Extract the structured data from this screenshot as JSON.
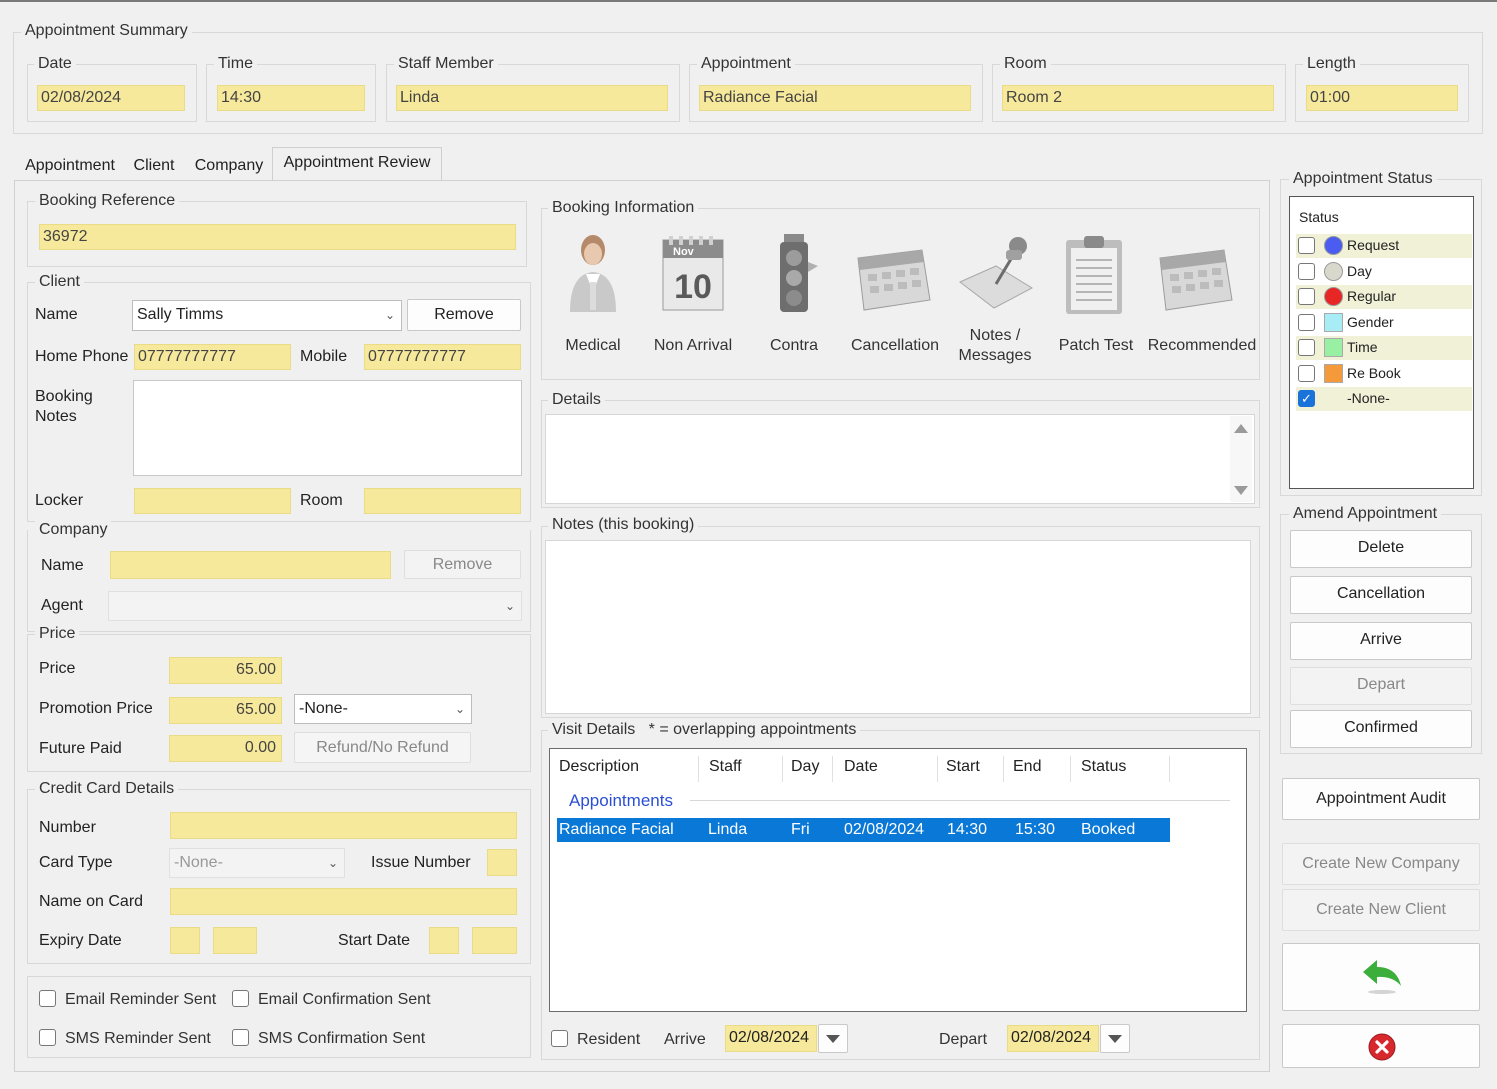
{
  "summary": {
    "title": "Appointment Summary",
    "date_label": "Date",
    "date": "02/08/2024",
    "time_label": "Time",
    "time": "14:30",
    "staff_label": "Staff Member",
    "staff": "Linda",
    "appt_label": "Appointment",
    "appt": "Radiance Facial",
    "room_label": "Room",
    "room": "Room 2",
    "length_label": "Length",
    "length": "01:00"
  },
  "tabs": [
    "Appointment",
    "Client",
    "Company",
    "Appointment Review"
  ],
  "booking_ref": {
    "title": "Booking Reference",
    "value": "36972"
  },
  "client": {
    "title": "Client",
    "name_label": "Name",
    "name": "Sally Timms",
    "remove": "Remove",
    "home_label": "Home Phone",
    "home": "07777777777",
    "mobile_label": "Mobile",
    "mobile": "07777777777",
    "notes_label_1": "Booking",
    "notes_label_2": "Notes",
    "locker_label": "Locker",
    "room_label": "Room"
  },
  "company": {
    "title": "Company",
    "name_label": "Name",
    "remove": "Remove",
    "agent_label": "Agent"
  },
  "price": {
    "title": "Price",
    "price_label": "Price",
    "price": "65.00",
    "promo_label": "Promotion Price",
    "promo": "65.00",
    "promo_select": "-None-",
    "future_label": "Future Paid",
    "future": "0.00",
    "refund": "Refund/No Refund"
  },
  "card": {
    "title": "Credit Card Details",
    "number_label": "Number",
    "type_label": "Card Type",
    "type_value": "-None-",
    "issue_label": "Issue Number",
    "name_label": "Name on Card",
    "expiry_label": "Expiry Date",
    "start_label": "Start Date"
  },
  "reminders": {
    "email_reminder": "Email Reminder Sent",
    "email_confirm": "Email Confirmation Sent",
    "sms_reminder": "SMS Reminder Sent",
    "sms_confirm": "SMS Confirmation Sent"
  },
  "booking_info": {
    "title": "Booking Information",
    "items": [
      "Medical",
      "Non Arrival",
      "Contra",
      "Cancellation",
      "Notes /",
      "Messages",
      "Patch Test",
      "Recommended"
    ],
    "calendar_month": "Nov",
    "calendar_day": "10"
  },
  "details": {
    "title": "Details"
  },
  "notes": {
    "title": "Notes (this booking)"
  },
  "visit": {
    "title": "Visit Details",
    "note": "* = overlapping appointments",
    "columns": [
      "Description",
      "Staff",
      "Day",
      "Date",
      "Start",
      "End",
      "Status"
    ],
    "group_label": "Appointments",
    "rows": [
      [
        "Radiance Facial",
        "Linda",
        "Fri",
        "02/08/2024",
        "14:30",
        "15:30",
        "Booked"
      ]
    ],
    "resident": "Resident",
    "arrive_label": "Arrive",
    "arrive": "02/08/2024",
    "depart_label": "Depart",
    "depart": "02/08/2024"
  },
  "status": {
    "title": "Appointment Status",
    "header": "Status",
    "items": [
      {
        "label": "Request",
        "color": "#4a5df0",
        "checked": false
      },
      {
        "label": "Day",
        "color": "#d8d8cc",
        "checked": false
      },
      {
        "label": "Regular",
        "color": "#e82626",
        "checked": false
      },
      {
        "label": "Gender",
        "color": "#a8ecf5",
        "checked": false
      },
      {
        "label": "Time",
        "color": "#9af0a2",
        "checked": false
      },
      {
        "label": "Re Book",
        "color": "#f59a3a",
        "checked": false
      },
      {
        "label": "-None-",
        "color": "",
        "checked": true
      }
    ]
  },
  "amend": {
    "title": "Amend Appointment",
    "delete": "Delete",
    "cancellation": "Cancellation",
    "arrive": "Arrive",
    "depart": "Depart",
    "confirmed": "Confirmed"
  },
  "actions": {
    "audit": "Appointment Audit",
    "new_company": "Create New Company",
    "new_client": "Create New Client"
  },
  "colors": {
    "field_yellow": "#f7e99b",
    "selection_blue": "#0a78d7",
    "group_link": "#2b4fd4"
  }
}
